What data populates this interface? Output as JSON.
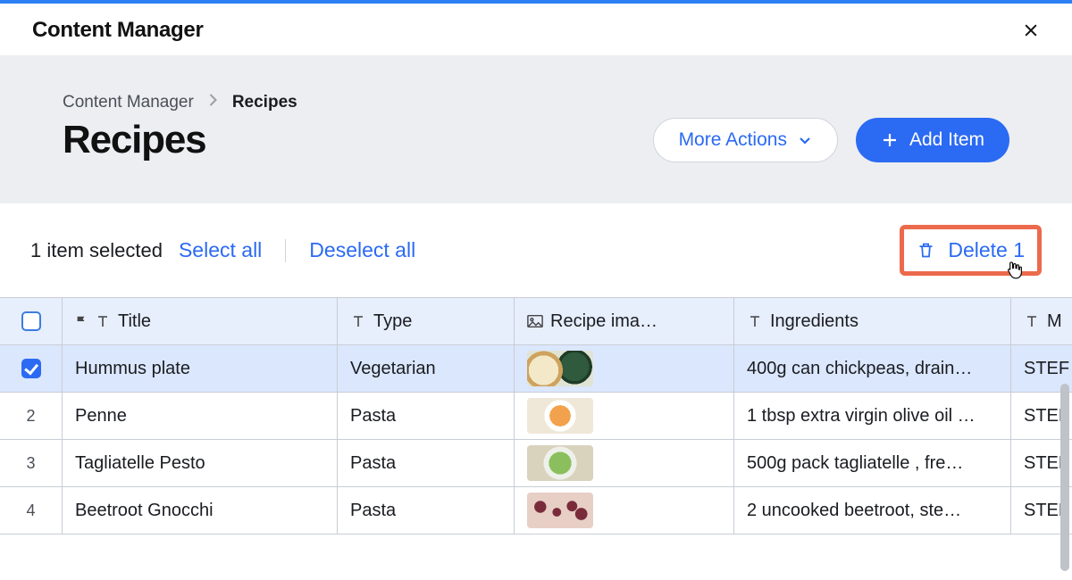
{
  "modal": {
    "title": "Content Manager"
  },
  "breadcrumb": {
    "root": "Content Manager",
    "current": "Recipes"
  },
  "page": {
    "title": "Recipes"
  },
  "actions": {
    "more": "More Actions",
    "add": "Add Item"
  },
  "selection": {
    "count_text": "1 item selected",
    "select_all": "Select all",
    "deselect_all": "Deselect all",
    "delete_label": "Delete 1"
  },
  "columns": {
    "title": "Title",
    "type": "Type",
    "image": "Recipe ima…",
    "ingredients": "Ingredients",
    "steps_initial": "M"
  },
  "rows": [
    {
      "idx": "",
      "selected": true,
      "title": "Hummus plate",
      "type": "Vegetarian",
      "ingredients": "400g can chickpeas, drain…",
      "steps": "STEF",
      "thumb": "th-hummus"
    },
    {
      "idx": "2",
      "selected": false,
      "title": "Penne",
      "type": "Pasta",
      "ingredients": "1 tbsp extra virgin olive oil …",
      "steps": "STEF",
      "thumb": "th-penne"
    },
    {
      "idx": "3",
      "selected": false,
      "title": "Tagliatelle Pesto",
      "type": "Pasta",
      "ingredients": "500g pack tagliatelle , fre…",
      "steps": "STEF",
      "thumb": "th-pesto"
    },
    {
      "idx": "4",
      "selected": false,
      "title": "Beetroot Gnocchi",
      "type": "Pasta",
      "ingredients": "2 uncooked beetroot, ste…",
      "steps": "STEF",
      "thumb": "th-beet"
    }
  ],
  "colors": {
    "accent": "#2b6af3",
    "highlight_border": "#ec6a4c"
  }
}
